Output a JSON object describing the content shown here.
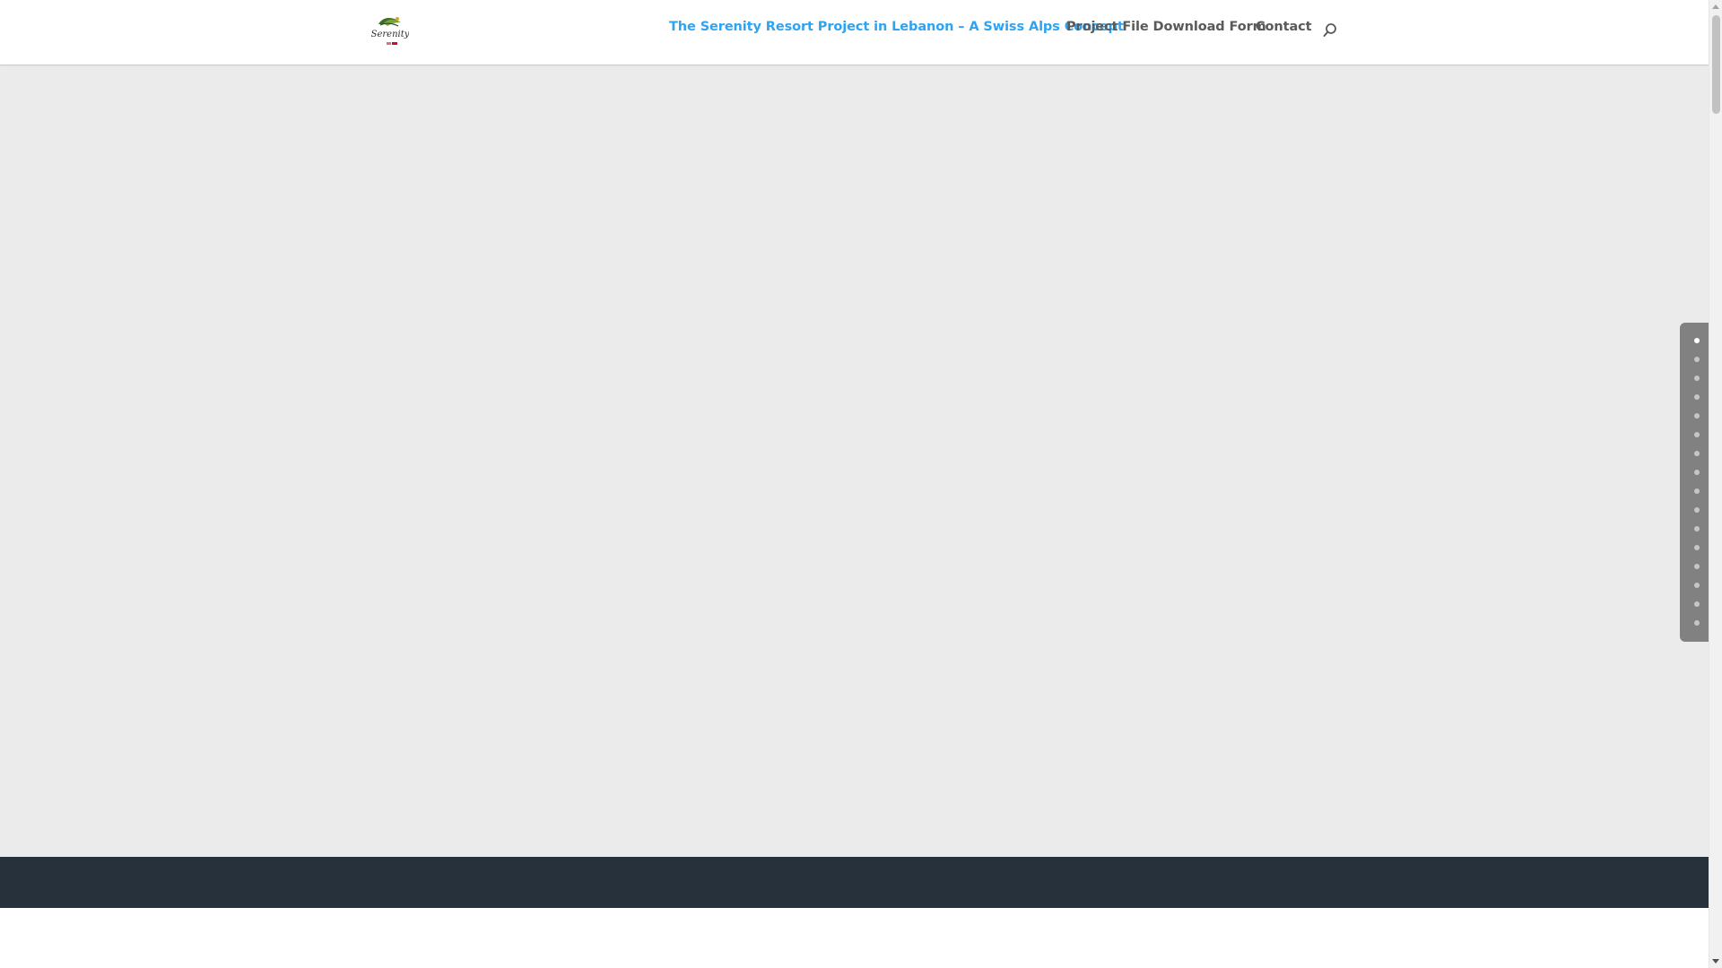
{
  "header": {
    "logo_icon": "serenity-logo",
    "logo_text": "Serenity",
    "nav": [
      {
        "label": "The Serenity Resort Project in Lebanon – A Swiss Alps Concept",
        "active": true
      },
      {
        "label": "Project File Download Form",
        "active": false
      },
      {
        "label": "Contact",
        "active": false
      }
    ],
    "search_icon": "search-icon"
  },
  "colors": {
    "accent": "#2ea3f2",
    "nav_text": "#5a5a5a",
    "hero_background": "#ebebeb",
    "footer_band": "#27313b"
  },
  "dot_navigation": {
    "count": 16,
    "active_index": 0
  }
}
